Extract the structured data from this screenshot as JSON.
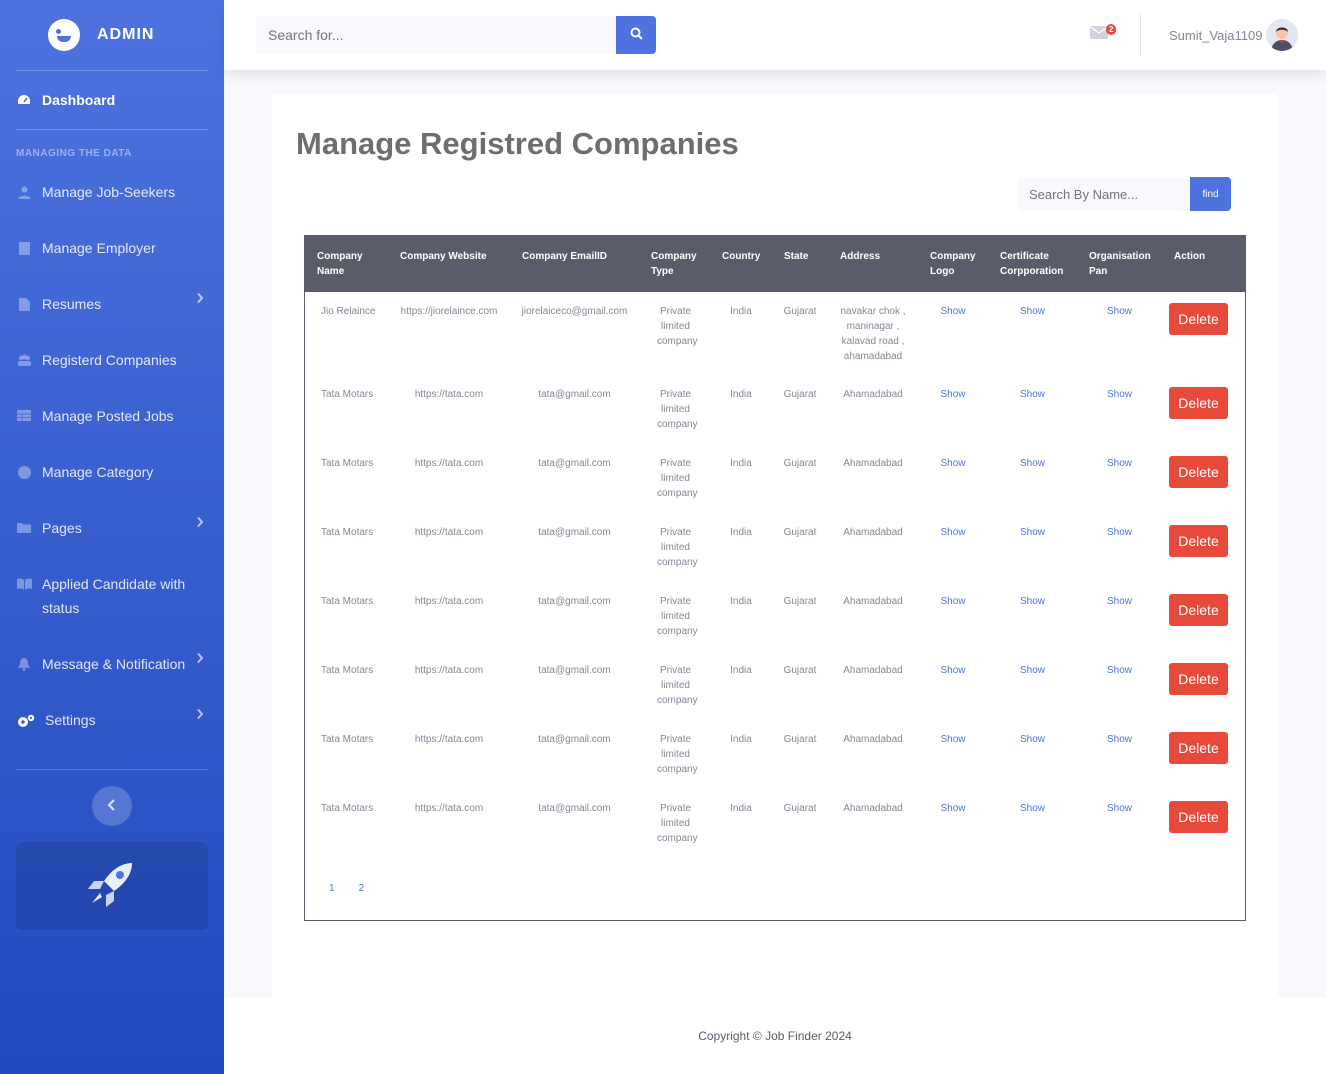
{
  "sidebar": {
    "brand": "ADMIN",
    "dashboard": "Dashboard",
    "heading": "MANAGING THE DATA",
    "items": [
      {
        "label": "Manage Job-Seekers",
        "icon": "user-icon"
      },
      {
        "label": "Manage Employer",
        "icon": "building-icon"
      },
      {
        "label": "Resumes",
        "icon": "file-icon",
        "chevron": true
      },
      {
        "label": "Registerd Companies",
        "icon": "users-icon"
      },
      {
        "label": "Manage Posted Jobs",
        "icon": "table-icon"
      },
      {
        "label": "Manage Category",
        "icon": "globe-icon"
      },
      {
        "label": "Pages",
        "icon": "folder-icon",
        "chevron": true
      },
      {
        "label": "Applied Candidate with status",
        "icon": "book-icon"
      },
      {
        "label": "Message & Notification",
        "icon": "bell-icon",
        "chevron": true
      },
      {
        "label": "Settings",
        "icon": "cogs-icon",
        "chevron": true
      }
    ]
  },
  "topbar": {
    "search_placeholder": "Search for...",
    "message_count": "2",
    "username": "Sumit_Vaja1109"
  },
  "main": {
    "title": "Manage Registred Companies",
    "find_placeholder": "Search By Name...",
    "find_label": "find",
    "columns": [
      "Company Name",
      "Company Website",
      "Company EmailID",
      "Company Type",
      "Country",
      "State",
      "Address",
      "Company Logo",
      "Certificate Corpporation",
      "Organisation Pan",
      "Action"
    ],
    "rows": [
      {
        "name": "Jio Relaince",
        "website": "https://jiorelaince.com",
        "email": "jiorelaiceco@gmail.com",
        "type": "Private limited company",
        "country": "India",
        "state": "Gujarat",
        "address": "navakar chok , maninagar , kalavad road , ahamadabad",
        "logo": "Show",
        "cert": "Show",
        "pan": "Show",
        "action": "Delete"
      },
      {
        "name": "Tata Motars",
        "website": "https://tata.com",
        "email": "tata@gmail.com",
        "type": "Private limited company",
        "country": "India",
        "state": "Gujarat",
        "address": "Ahamadabad",
        "logo": "Show",
        "cert": "Show",
        "pan": "Show",
        "action": "Delete"
      },
      {
        "name": "Tata Motars",
        "website": "https://tata.com",
        "email": "tata@gmail.com",
        "type": "Private limited company",
        "country": "India",
        "state": "Gujarat",
        "address": "Ahamadabad",
        "logo": "Show",
        "cert": "Show",
        "pan": "Show",
        "action": "Delete"
      },
      {
        "name": "Tata Motars",
        "website": "https://tata.com",
        "email": "tata@gmail.com",
        "type": "Private limited company",
        "country": "India",
        "state": "Gujarat",
        "address": "Ahamadabad",
        "logo": "Show",
        "cert": "Show",
        "pan": "Show",
        "action": "Delete"
      },
      {
        "name": "Tata Motars",
        "website": "https://tata.com",
        "email": "tata@gmail.com",
        "type": "Private limited company",
        "country": "India",
        "state": "Gujarat",
        "address": "Ahamadabad",
        "logo": "Show",
        "cert": "Show",
        "pan": "Show",
        "action": "Delete"
      },
      {
        "name": "Tata Motars",
        "website": "https://tata.com",
        "email": "tata@gmail.com",
        "type": "Private limited company",
        "country": "India",
        "state": "Gujarat",
        "address": "Ahamadabad",
        "logo": "Show",
        "cert": "Show",
        "pan": "Show",
        "action": "Delete"
      },
      {
        "name": "Tata Motars",
        "website": "https://tata.com",
        "email": "tata@gmail.com",
        "type": "Private limited company",
        "country": "India",
        "state": "Gujarat",
        "address": "Ahamadabad",
        "logo": "Show",
        "cert": "Show",
        "pan": "Show",
        "action": "Delete"
      },
      {
        "name": "Tata Motars",
        "website": "https://tata.com",
        "email": "tata@gmail.com",
        "type": "Private limited company",
        "country": "India",
        "state": "Gujarat",
        "address": "Ahamadabad",
        "logo": "Show",
        "cert": "Show",
        "pan": "Show",
        "action": "Delete"
      }
    ],
    "pages": [
      "1",
      "2"
    ]
  },
  "footer": {
    "copyright": "Copyright © Job Finder 2024"
  },
  "colors": {
    "primary": "#4e73df",
    "danger": "#e74a3b",
    "table_header": "#5a5c69"
  }
}
